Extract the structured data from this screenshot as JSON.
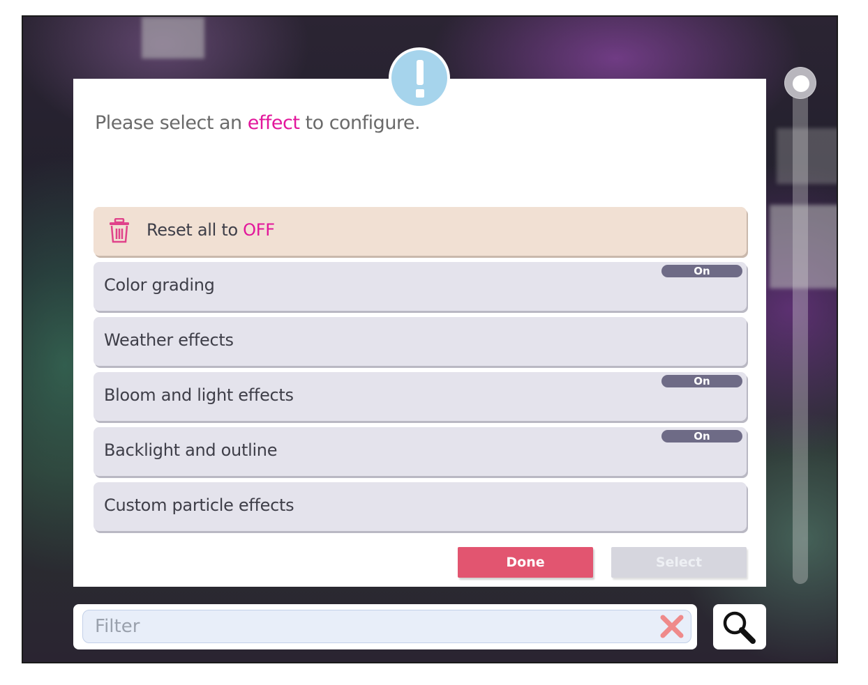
{
  "dialog": {
    "prompt_before": "Please select an ",
    "prompt_highlight": "effect",
    "prompt_after": " to configure."
  },
  "reset": {
    "label_before": "Reset all to ",
    "label_highlight": "OFF",
    "icon": "trash-icon"
  },
  "effects": [
    {
      "label": "Color grading",
      "status": "On"
    },
    {
      "label": "Weather effects",
      "status": ""
    },
    {
      "label": "Bloom and light effects",
      "status": "On"
    },
    {
      "label": "Backlight and outline",
      "status": "On"
    },
    {
      "label": "Custom particle effects",
      "status": ""
    }
  ],
  "buttons": {
    "done": "Done",
    "select": "Select"
  },
  "filter": {
    "placeholder": "Filter",
    "clear_icon": "close-icon",
    "search_icon": "search-icon"
  },
  "colors": {
    "accent": "#e2169b",
    "done_button": "#e25570",
    "alert_badge": "#a6d4ec",
    "row_bg": "#e4e3ec",
    "reset_row_bg": "#f1e0d3",
    "status_badge": "#6e6b86"
  }
}
